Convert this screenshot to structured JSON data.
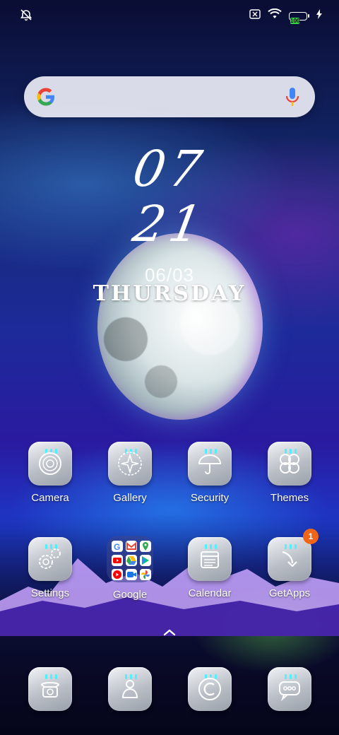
{
  "status_bar": {
    "left_icon": "alarm-off-icon",
    "right_icons": [
      "no-sim-icon",
      "wifi-icon",
      "battery-icon",
      "charging-bolt-icon"
    ],
    "battery_level": "100"
  },
  "search": {
    "logo": "google-g-logo",
    "mic_icon": "microphone-icon"
  },
  "clock_widget": {
    "hour": "07",
    "minute": "21",
    "date": "06/03",
    "weekday": "THURSDAY"
  },
  "apps_row1": [
    {
      "label": "Camera",
      "icon": "camera-lens-icon"
    },
    {
      "label": "Gallery",
      "icon": "gallery-flower-icon"
    },
    {
      "label": "Security",
      "icon": "umbrella-icon"
    },
    {
      "label": "Themes",
      "icon": "clover-icon"
    }
  ],
  "apps_row2": [
    {
      "label": "Settings",
      "icon": "settings-gears-icon"
    },
    {
      "label": "Google",
      "icon": "google-folder-icon"
    },
    {
      "label": "Calendar",
      "icon": "calendar-icon"
    },
    {
      "label": "GetApps",
      "icon": "getapps-arrow-icon",
      "badge": "1"
    }
  ],
  "dock": [
    {
      "icon": "phone-icon"
    },
    {
      "icon": "contacts-icon"
    },
    {
      "icon": "chrome-c-icon"
    },
    {
      "icon": "messages-bubble-icon"
    }
  ],
  "app_drawer_hint": {
    "icon": "chevron-up-icon"
  },
  "colors": {
    "battery": "#31d843",
    "badge": "#f0651a",
    "drops": "#4ff0ff",
    "search_bg": "#ebebf5"
  }
}
